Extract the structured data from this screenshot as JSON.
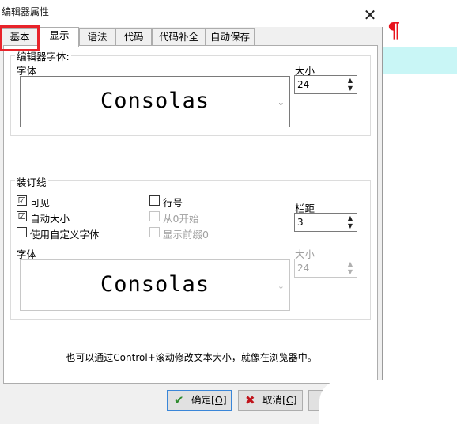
{
  "window": {
    "title": "编辑器属性",
    "close": "✕"
  },
  "tabs": [
    {
      "label": "基本"
    },
    {
      "label": "显示"
    },
    {
      "label": "语法"
    },
    {
      "label": "代码"
    },
    {
      "label": "代码补全"
    },
    {
      "label": "自动保存"
    }
  ],
  "active_tab": "显示",
  "editor_font": {
    "group_label": "编辑器字体:",
    "font_label": "字体",
    "font_value": "Consolas",
    "size_label": "大小",
    "size_value": "24"
  },
  "gutter": {
    "group_label": "装订线",
    "visible": {
      "label": "可见",
      "checked": "☑"
    },
    "auto_size": {
      "label": "自动大小",
      "checked": "☑"
    },
    "custom_font": {
      "label": "使用自定义字体"
    },
    "line_numbers": {
      "label": "行号"
    },
    "start_zero": {
      "label": "从0开始"
    },
    "show_leading_zero": {
      "label": "显示前缀0"
    },
    "margin_label": "栏距",
    "margin_value": "3",
    "font_label": "字体",
    "font_value": "Consolas",
    "size_label": "大小",
    "size_value": "24"
  },
  "hint": "也可以通过Control+滚动修改文本大小，就像在浏览器中。",
  "buttons": {
    "ok": {
      "label": "确定",
      "hotkey": "[O]"
    },
    "cancel": {
      "label": "取消",
      "hotkey": "[C]"
    }
  },
  "icons": {
    "ok": "checkmark-icon",
    "cancel": "x-icon",
    "dropdown": "chevron-down-icon"
  },
  "colors": {
    "highlight": "#e8232a",
    "ok_icon": "#2e8b2e",
    "cancel_icon": "#c0141c",
    "editor_line": "#c9f6f6"
  }
}
